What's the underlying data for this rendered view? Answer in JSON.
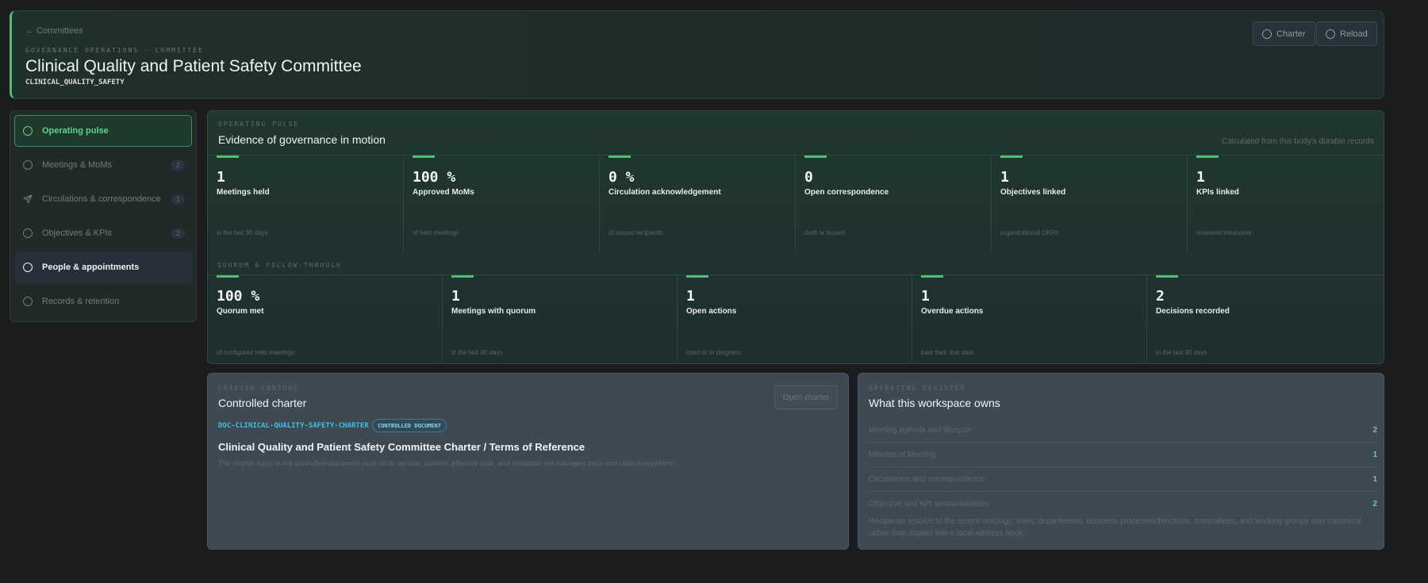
{
  "header": {
    "back_label": "← Committees",
    "eyebrow": "GOVERNANCE OPERATIONS · COMMITTEE",
    "title": "Clinical Quality and Patient Safety Committee",
    "code": "CLINICAL_QUALITY_SAFETY",
    "buttons": {
      "charter": "Charter",
      "reload": "Reload"
    }
  },
  "sidebar": {
    "items": [
      {
        "label": "Operating pulse",
        "count": "",
        "state": "active",
        "icon": "circle-icon"
      },
      {
        "label": "Meetings & MoMs",
        "count": "2",
        "state": "",
        "icon": "circle-icon"
      },
      {
        "label": "Circulations & correspondence",
        "count": "1",
        "state": "",
        "icon": "send-icon"
      },
      {
        "label": "Objectives & KPIs",
        "count": "2",
        "state": "",
        "icon": "circle-icon"
      },
      {
        "label": "People & appointments",
        "count": "",
        "state": "hover",
        "icon": "circle-icon"
      },
      {
        "label": "Records & retention",
        "count": "",
        "state": "",
        "icon": "circle-icon"
      }
    ]
  },
  "pulse": {
    "eyebrow": "OPERATING PULSE",
    "title": "Evidence of governance in motion",
    "note": "Calculated from this body's durable records",
    "row1": [
      {
        "value": "1",
        "label": "Meetings held",
        "sub": "in the last 90 days"
      },
      {
        "value": "100 %",
        "label": "Approved MoMs",
        "sub": "of held meetings"
      },
      {
        "value": "0 %",
        "label": "Circulation acknowledgement",
        "sub": "of issued recipients"
      },
      {
        "value": "0",
        "label": "Open correspondence",
        "sub": "draft or issued"
      },
      {
        "value": "1",
        "label": "Objectives linked",
        "sub": "organizational OKRs"
      },
      {
        "value": "1",
        "label": "KPIs linked",
        "sub": "reviewed measures"
      }
    ],
    "quorum_eyebrow": "QUORUM & FOLLOW-THROUGH",
    "row2": [
      {
        "value": "100 %",
        "label": "Quorum met",
        "sub": "of configured held meetings"
      },
      {
        "value": "1",
        "label": "Meetings with quorum",
        "sub": "in the last 90 days"
      },
      {
        "value": "1",
        "label": "Open actions",
        "sub": "open or in progress"
      },
      {
        "value": "1",
        "label": "Overdue actions",
        "sub": "past their due date"
      },
      {
        "value": "2",
        "label": "Decisions recorded",
        "sub": "in the last 90 days"
      }
    ]
  },
  "charter": {
    "eyebrow": "CHARTER CONTROL",
    "title": "Controlled charter",
    "open_button": "Open charter",
    "doc_code": "DOC-CLINICAL-QUALITY-SAFETY-CHARTER",
    "badge": "CONTROLLED DOCUMENT",
    "doc_title": "Clinical Quality and Patient Safety Committee Charter / Terms of Reference",
    "doc_desc": "The charter stays in the controlled-document vault so its version, content, effective date, and metadata are managed once and used everywhere."
  },
  "register": {
    "eyebrow": "OPERATING REGISTER",
    "title": "What this workspace owns",
    "rows": [
      {
        "label": "Meeting agenda and lifecycle",
        "count": "2"
      },
      {
        "label": "Minutes of Meeting",
        "count": "1"
      },
      {
        "label": "Circulations and correspondence",
        "count": "1"
      },
      {
        "label": "Objective and KPI accountabilities",
        "count": "2"
      }
    ],
    "note": "Recipients resolve to the tenant ontology: roles, departments, business processes/functions, committees, and working groups stay canonical rather than copied into a local address book."
  }
}
